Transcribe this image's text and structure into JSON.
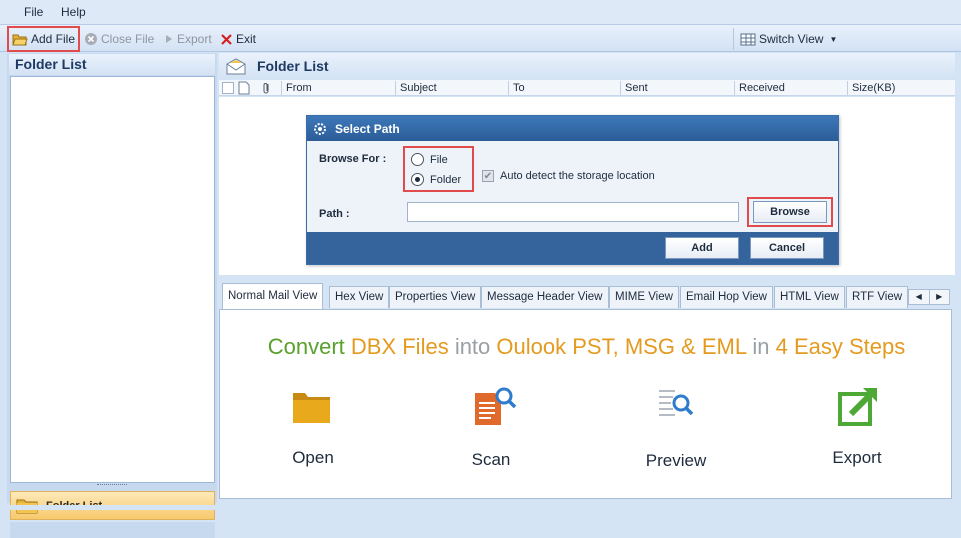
{
  "menu": {
    "file": "File",
    "help": "Help"
  },
  "toolbar": {
    "add_file": "Add File",
    "close_file": "Close File",
    "export": "Export",
    "exit": "Exit",
    "switch_view": "Switch View"
  },
  "left_panel": {
    "title": "Folder List",
    "folder_button": "Folder List"
  },
  "right_panel": {
    "title": "Folder List",
    "columns": [
      "From",
      "Subject",
      "To",
      "Sent",
      "Received",
      "Size(KB)"
    ]
  },
  "dialog": {
    "title": "Select Path",
    "browse_for_label": "Browse For :",
    "option_file": "File",
    "option_folder": "Folder",
    "selected_option": "Folder",
    "auto_detect_label": "Auto detect the storage location",
    "auto_detect_checked": true,
    "path_label": "Path :",
    "path_value": "",
    "browse_button": "Browse",
    "add_button": "Add",
    "cancel_button": "Cancel"
  },
  "tabs": [
    "Normal Mail View",
    "Hex View",
    "Properties View",
    "Message Header View",
    "MIME View",
    "Email Hop View",
    "HTML View",
    "RTF View"
  ],
  "active_tab": "Normal Mail View",
  "promo": {
    "part1": "Convert",
    "part2": "DBX Files",
    "part3": "into",
    "part4": "Oulook PST, MSG & EML",
    "part5": "in",
    "part6": "4 Easy Steps",
    "steps": [
      "Open",
      "Scan",
      "Preview",
      "Export"
    ]
  },
  "colors": {
    "accent_blue": "#2b5c98",
    "highlight_red": "#e14b4b",
    "promo_green": "#5aa02c",
    "promo_orange": "#e49a1f",
    "promo_gray": "#9aa0a6"
  }
}
